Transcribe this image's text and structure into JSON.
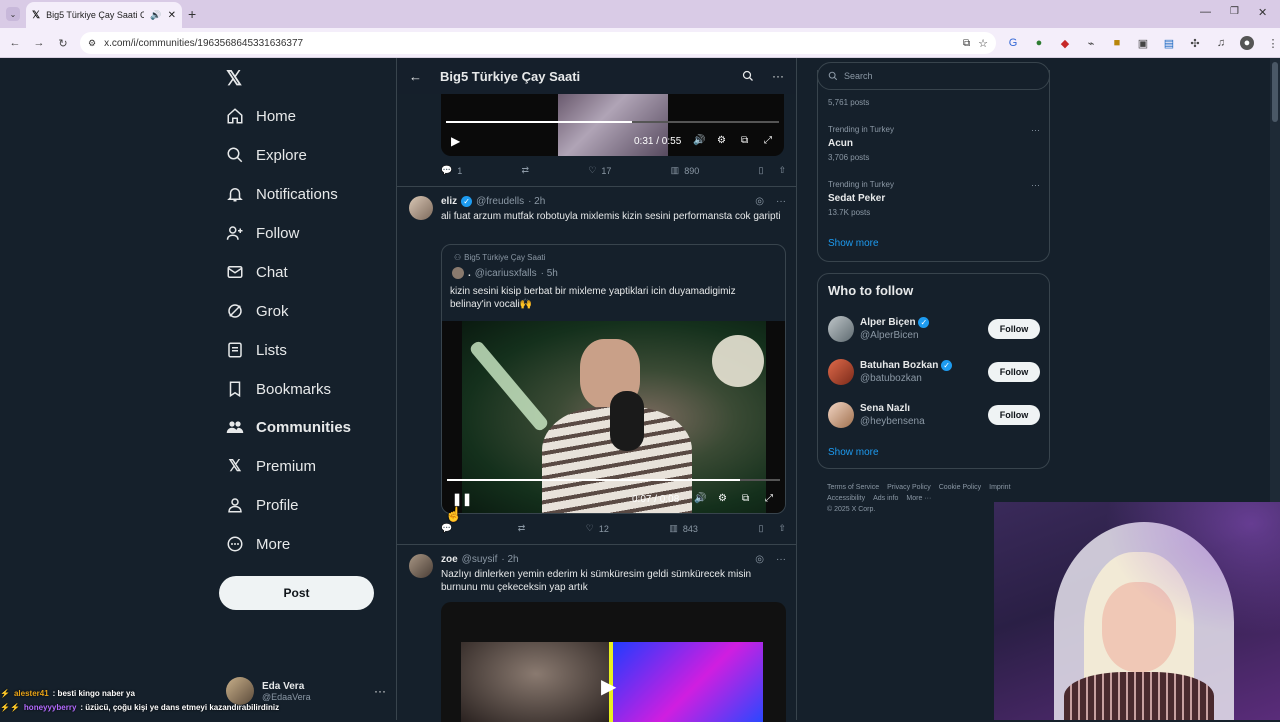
{
  "browser": {
    "tab_title": "Big5 Türkiye Çay Saati Com",
    "url": "x.com/i/communities/1963568645331636377"
  },
  "nav": {
    "items": [
      {
        "label": "Home",
        "icon": "home-icon"
      },
      {
        "label": "Explore",
        "icon": "search-icon"
      },
      {
        "label": "Notifications",
        "icon": "bell-icon"
      },
      {
        "label": "Follow",
        "icon": "person-add-icon"
      },
      {
        "label": "Chat",
        "icon": "mail-icon"
      },
      {
        "label": "Grok",
        "icon": "grok-icon"
      },
      {
        "label": "Lists",
        "icon": "list-icon"
      },
      {
        "label": "Bookmarks",
        "icon": "bookmark-icon"
      },
      {
        "label": "Communities",
        "icon": "communities-icon"
      },
      {
        "label": "Premium",
        "icon": "x-icon"
      },
      {
        "label": "Profile",
        "icon": "profile-icon"
      },
      {
        "label": "More",
        "icon": "more-circle-icon"
      }
    ],
    "post_label": "Post",
    "account": {
      "name": "Eda Vera",
      "handle": "@EdaaVera"
    }
  },
  "header": {
    "title": "Big5 Türkiye Çay Saati"
  },
  "posts": [
    {
      "video": {
        "time": "0:31 / 0:55",
        "progress": 0.56
      },
      "actions": {
        "replies": "1",
        "likes": "17",
        "views": "890"
      }
    },
    {
      "name": "eliz",
      "handle": "@freudells",
      "time": "· 2h",
      "text": "ali fuat arzum mutfak robotuyla mixlemis kizin sesini performansta cok garipti",
      "quote": {
        "community": "Big5 Türkiye Çay Saati",
        "name": ".",
        "handle": "@icariusxfalls",
        "time": "· 5h",
        "text": "kizin sesini kisip berbat bir mixleme yaptiklari icin duyamadigimiz belinay'in vocali🙌"
      },
      "video": {
        "time": "0:07 / 0:08",
        "progress": 0.88
      },
      "actions": {
        "replies": "",
        "likes": "12",
        "views": "843"
      }
    },
    {
      "name": "zoe",
      "handle": "@suysif",
      "time": "· 2h",
      "text": "Nazlıyı dinlerken yemin ederim ki sümküresim geldi sümkürecek misin burnunu mu çekeceksin yap artık"
    }
  ],
  "search": {
    "placeholder": "Search"
  },
  "trends": [
    {
      "category": "",
      "name": "",
      "count": "5,761 posts"
    },
    {
      "category": "Trending in Turkey",
      "name": "Acun",
      "count": "3,706 posts"
    },
    {
      "category": "Trending in Turkey",
      "name": "Sedat Peker",
      "count": "13.7K posts"
    }
  ],
  "trends_show_more": "Show more",
  "who_to_follow": {
    "title": "Who to follow",
    "follow_label": "Follow",
    "users": [
      {
        "name": "Alper Biçen",
        "handle": "@AlperBicen"
      },
      {
        "name": "Batuhan Bozkan",
        "handle": "@batubozkan"
      },
      {
        "name": "Sena Nazlı",
        "handle": "@heybensena"
      }
    ],
    "show_more": "Show more"
  },
  "footer": {
    "links": [
      "Terms of Service",
      "Privacy Policy",
      "Cookie Policy",
      "Imprint",
      "Accessibility",
      "Ads info",
      "More ···"
    ],
    "copyright": "© 2025 X Corp."
  },
  "chat": [
    {
      "user": "alester41",
      "message": ": besti kingo naber ya",
      "color": "#e8a317"
    },
    {
      "user": "honeyyyberry",
      "message": ": üzücü, çoğu kişi ye dans etmeyi kazandırabilirdiniz",
      "color": "#b36bff"
    }
  ],
  "colors": {
    "bg": "#15202b",
    "border": "#38444d",
    "accent": "#1d9bf0",
    "muted": "#8b98a5"
  }
}
